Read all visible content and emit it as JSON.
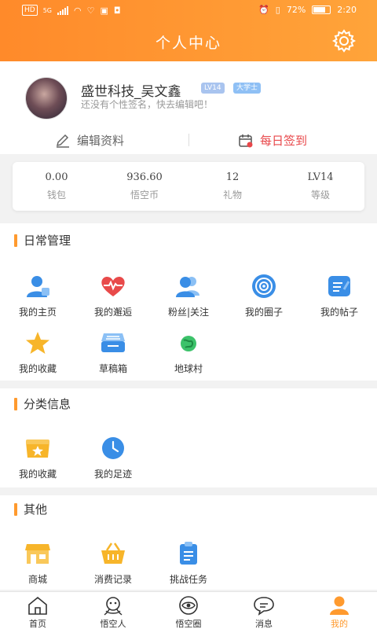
{
  "status_bar": {
    "signal_label": "HD",
    "net_label": "5G",
    "battery": "72%",
    "time": "2:20"
  },
  "header": {
    "title": "个人中心"
  },
  "profile": {
    "name": "盛世科技_吴文鑫",
    "level_tag": "LV14",
    "title_tag": "大学士",
    "signature": "还没有个性签名，快去编辑吧！",
    "edit_label": "编辑资料",
    "checkin_label": "每日签到"
  },
  "stats": [
    {
      "value": "0.00",
      "label": "钱包"
    },
    {
      "value": "936.60",
      "label": "悟空币"
    },
    {
      "value": "12",
      "label": "礼物"
    },
    {
      "value": "LV14",
      "label": "等级"
    }
  ],
  "daily": {
    "title": "日常管理",
    "items": [
      {
        "label": "我的主页",
        "icon": "user-home-icon"
      },
      {
        "label": "我的邂逅",
        "icon": "heart-pulse-icon"
      },
      {
        "label": "粉丝|关注",
        "icon": "followers-icon"
      },
      {
        "label": "我的圈子",
        "icon": "circle-target-icon"
      },
      {
        "label": "我的帖子",
        "icon": "post-icon"
      },
      {
        "label": "我的收藏",
        "icon": "star-icon"
      },
      {
        "label": "草稿箱",
        "icon": "drafts-icon"
      },
      {
        "label": "地球村",
        "icon": "globe-icon"
      }
    ]
  },
  "category": {
    "title": "分类信息",
    "items": [
      {
        "label": "我的收藏",
        "icon": "favorite-box-icon"
      },
      {
        "label": "我的足迹",
        "icon": "clock-icon"
      }
    ]
  },
  "other": {
    "title": "其他",
    "items": [
      {
        "label": "商城",
        "icon": "shop-icon"
      },
      {
        "label": "消费记录",
        "icon": "basket-icon"
      },
      {
        "label": "挑战任务",
        "icon": "clipboard-icon"
      }
    ]
  },
  "tabs": [
    {
      "label": "首页",
      "icon": "home-icon"
    },
    {
      "label": "悟空人",
      "icon": "monkey-icon"
    },
    {
      "label": "悟空圈",
      "icon": "eye-circle-icon"
    },
    {
      "label": "消息",
      "icon": "message-icon"
    },
    {
      "label": "我的",
      "icon": "me-icon",
      "active": true
    }
  ],
  "colors": {
    "accent": "#ff9a2e",
    "header_start": "#ff8a2a",
    "header_end": "#ffa43a",
    "checkin": "#e8474a",
    "blue": "#3a8ee6"
  }
}
